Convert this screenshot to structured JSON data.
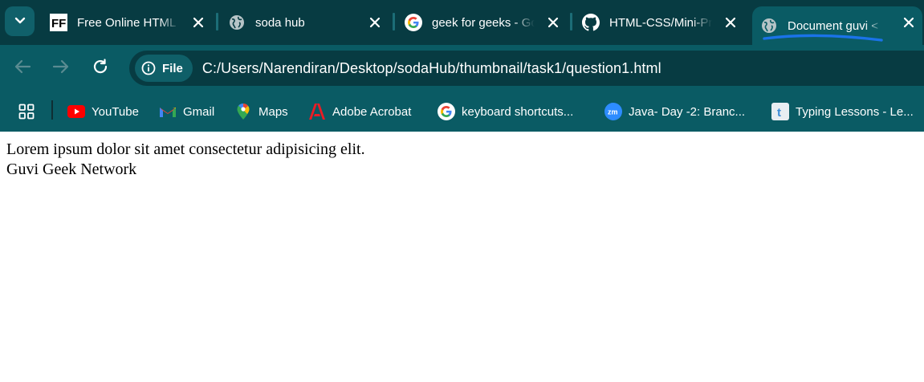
{
  "tabs": [
    {
      "title": "Free Online HTML Editor",
      "favicon": "ff-icon"
    },
    {
      "title": "soda hub",
      "favicon": "globe-icon"
    },
    {
      "title": "geek for geeks - Google Search",
      "favicon": "google-icon"
    },
    {
      "title": "HTML-CSS/Mini-Projects",
      "favicon": "github-icon"
    },
    {
      "title": "Document guvi <",
      "favicon": "globe-icon",
      "active": true
    }
  ],
  "omnibox": {
    "chip_label": "File",
    "url": "C:/Users/Narendiran/Desktop/sodaHub/thumbnail/task1/question1.html"
  },
  "bookmarks": [
    {
      "label": "YouTube",
      "icon": "youtube-icon"
    },
    {
      "label": "Gmail",
      "icon": "gmail-icon"
    },
    {
      "label": "Maps",
      "icon": "maps-icon"
    },
    {
      "label": "Adobe Acrobat",
      "icon": "acrobat-icon"
    },
    {
      "label": "keyboard shortcuts...",
      "icon": "google-icon"
    },
    {
      "label": "Java- Day -2: Branc...",
      "icon": "zoom-icon"
    },
    {
      "label": "Typing Lessons - Le...",
      "icon": "typing-icon"
    }
  ],
  "page": {
    "line1": "Lorem ipsum dolor sit amet consectetur adipisicing elit.",
    "line2": "Guvi Geek Network"
  },
  "colors": {
    "tabstrip": "#073b42",
    "toolbar": "#0a5b64",
    "accent_underline": "#1a73e8"
  }
}
